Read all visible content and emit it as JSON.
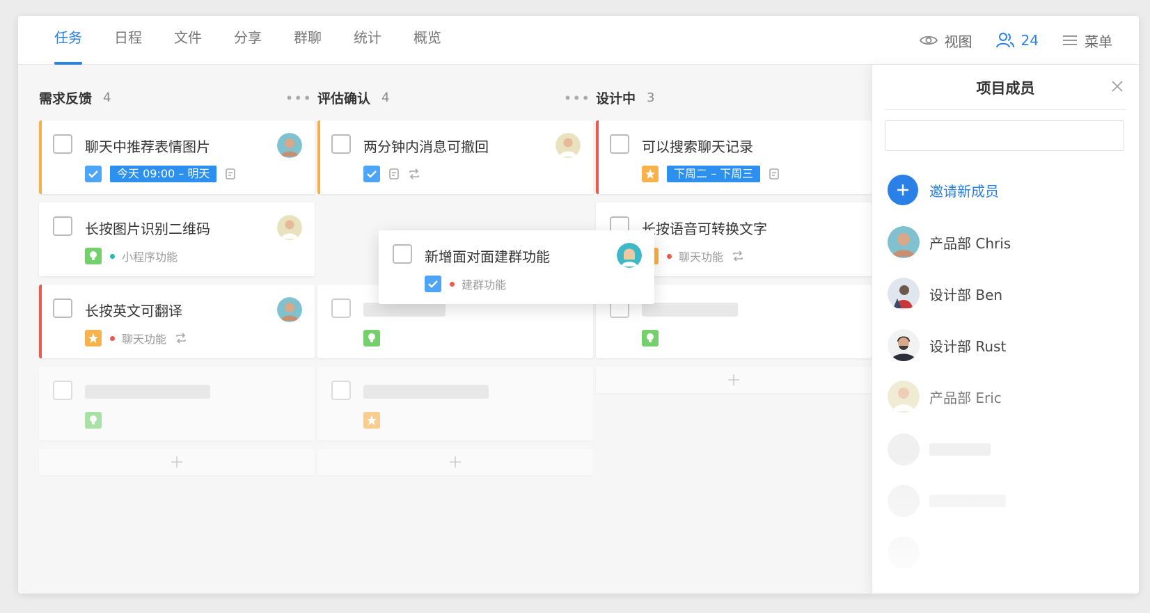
{
  "tabs": [
    {
      "label": "任务",
      "active": true
    },
    {
      "label": "日程"
    },
    {
      "label": "文件"
    },
    {
      "label": "分享"
    },
    {
      "label": "群聊"
    },
    {
      "label": "统计"
    },
    {
      "label": "概览"
    }
  ],
  "toolbar": {
    "view_label": "视图",
    "members_count": "24",
    "menu_label": "菜单",
    "view_icon": "eye-icon",
    "members_icon": "users-icon",
    "menu_icon": "hamburger-icon"
  },
  "colors": {
    "accent": "#2a80e6",
    "priority_orange": "#f6b04b",
    "priority_red": "#ec5a4f",
    "tag_teal": "#27b9b0"
  },
  "columns": [
    {
      "title": "需求反馈",
      "count": "4",
      "cards": [
        {
          "title": "聊天中推荐表情图片",
          "date": "今天 09:00 – 明天"
        },
        {
          "title": "长按图片识别二维码",
          "tag": "小程序功能"
        },
        {
          "title": "长按英文可翻译",
          "tag": "聊天功能"
        }
      ]
    },
    {
      "title": "评估确认",
      "count": "4",
      "cards": [
        {
          "title": "两分钟内消息可撤回"
        }
      ]
    },
    {
      "title": "设计中",
      "count": "3",
      "cards": [
        {
          "title": "可以搜索聊天记录",
          "date": "下周二 – 下周三"
        },
        {
          "title": "长按语音可转换文字",
          "tag": "聊天功能"
        }
      ]
    }
  ],
  "dragging_card": {
    "title": "新增面对面建群功能",
    "tag": "建群功能"
  },
  "panel": {
    "title": "项目成员",
    "invite_label": "邀请新成员",
    "members": [
      {
        "name": "产品部 Chris"
      },
      {
        "name": "设计部 Ben"
      },
      {
        "name": "设计部 Rust"
      },
      {
        "name": "产品部 Eric"
      }
    ]
  }
}
